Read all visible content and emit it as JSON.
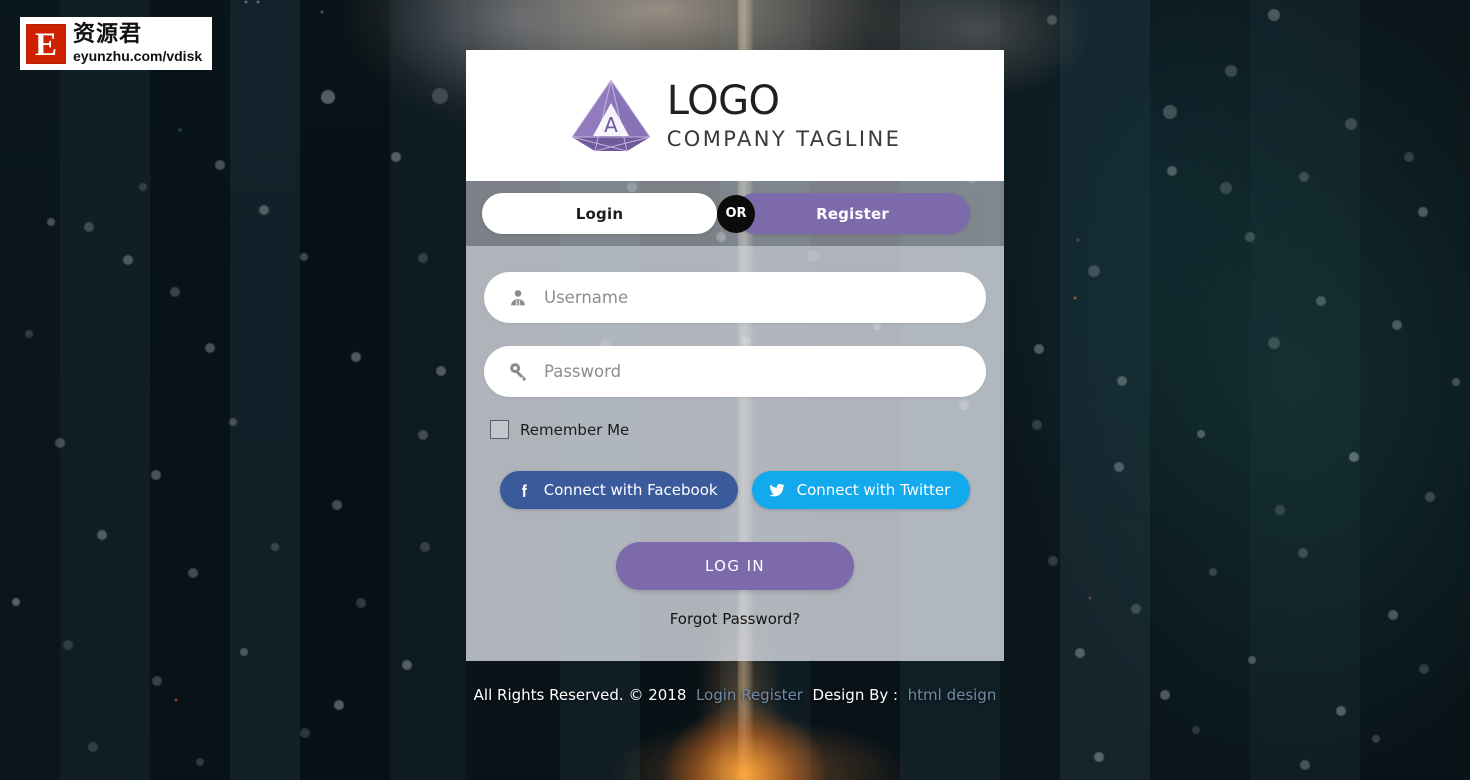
{
  "watermark": {
    "badge_letter": "E",
    "brand_cn": "资源君",
    "url": "eyunzhu.com/vdisk"
  },
  "card": {
    "header": {
      "logo_icon": "triangle-prism-logo",
      "logo_letter": "A",
      "title": "LOGO",
      "tagline": "COMPANY TAGLINE"
    },
    "tabs": {
      "login_label": "Login",
      "or_label": "OR",
      "register_label": "Register"
    },
    "form": {
      "username": {
        "icon": "user-icon",
        "placeholder": "Username",
        "value": ""
      },
      "password": {
        "icon": "key-icon",
        "placeholder": "Password",
        "value": ""
      },
      "remember_label": "Remember Me",
      "remember_checked": false,
      "facebook_label": "Connect with Facebook",
      "facebook_icon": "facebook-icon",
      "twitter_label": "Connect with Twitter",
      "twitter_icon": "twitter-icon",
      "submit_label": "LOG IN",
      "forgot_label": "Forgot Password?"
    }
  },
  "footer": {
    "copyright": "All Rights Reserved. © 2018",
    "link_login_register": "Login Register",
    "design_by": "Design By :",
    "link_html_design": "html design"
  },
  "colors": {
    "accent_purple": "#7d6aab",
    "facebook_blue": "#3b5a9b",
    "twitter_blue": "#12aaec",
    "or_badge": "#0b0b0b",
    "footer_link": "#6f8ba6",
    "watermark_red": "#cc2200"
  }
}
